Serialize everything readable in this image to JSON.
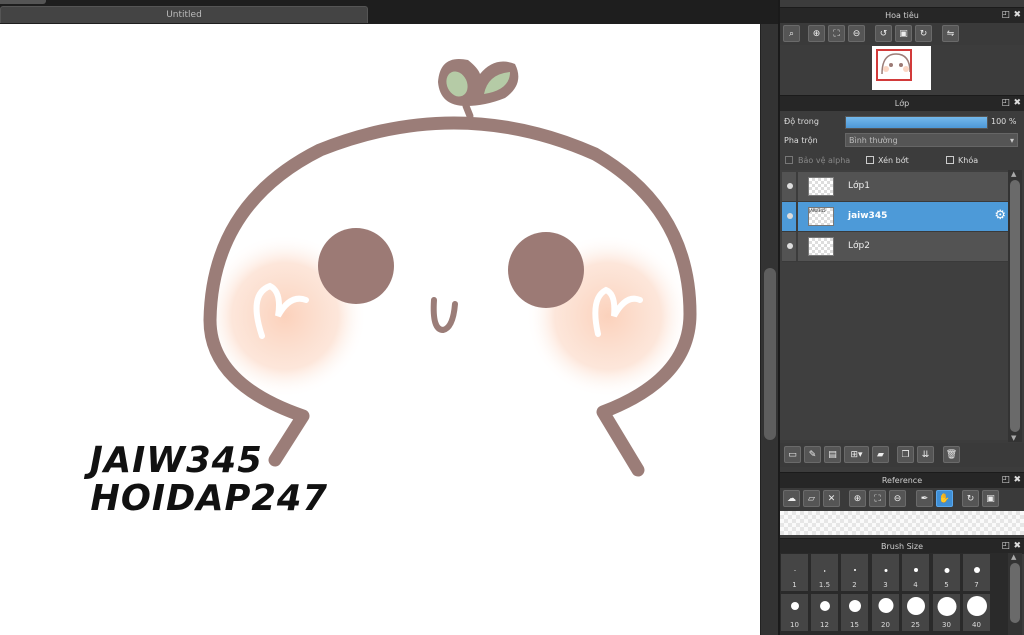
{
  "document": {
    "tab_title": "Untitled"
  },
  "canvas": {
    "watermark_line1": "JAIW345",
    "watermark_line2": "HOIDAP247"
  },
  "navigator": {
    "title": "Hoa tiêu",
    "tools": [
      "zoom-icon",
      "zoom-in-icon",
      "fit-icon",
      "zoom-out-icon",
      "rotate-left-icon",
      "fullscreen-icon",
      "rotate-right-icon",
      "flip-icon"
    ]
  },
  "layers_panel": {
    "title": "Lớp",
    "opacity_label": "Độ trong",
    "opacity_value": "100 %",
    "opacity_fraction": 1.0,
    "blend_label": "Pha trộn",
    "blend_value": "Bình thường",
    "protect_alpha_label": "Bảo vệ alpha",
    "clipping_label": "Xén bớt",
    "lock_label": "Khóa",
    "layers": [
      {
        "name": "Lớp1",
        "selected": false,
        "thumb": ""
      },
      {
        "name": "jaiw345",
        "selected": true,
        "thumb": "JAIW345"
      },
      {
        "name": "Lớp2",
        "selected": false,
        "thumb": ""
      }
    ],
    "bottom_tools": [
      "new-layer-icon",
      "new-vector-layer-icon",
      "new-halftone-layer-icon",
      "add-layer-menu-icon",
      "new-folder-icon",
      "duplicate-layer-icon",
      "merge-layer-icon",
      "delete-layer-icon"
    ]
  },
  "reference_panel": {
    "title": "Reference",
    "tools": [
      "load-icon",
      "open-folder-icon",
      "close-icon",
      "zoom-in-icon",
      "fit-icon",
      "zoom-out-icon",
      "eyedropper-icon",
      "hand-icon",
      "rotate-icon",
      "fullscreen-icon"
    ]
  },
  "brush_size_panel": {
    "title": "Brush Size",
    "sizes": [
      "1",
      "1.5",
      "2",
      "3",
      "4",
      "5",
      "7",
      "10",
      "12",
      "15",
      "20",
      "25",
      "30",
      "40"
    ]
  },
  "colors": {
    "character_outline": "#9b7d78",
    "eyes": "#9c7a75",
    "leaf": "#b5cba6",
    "blush": "#fbd6c4",
    "selected_layer": "#4d9ad8"
  }
}
